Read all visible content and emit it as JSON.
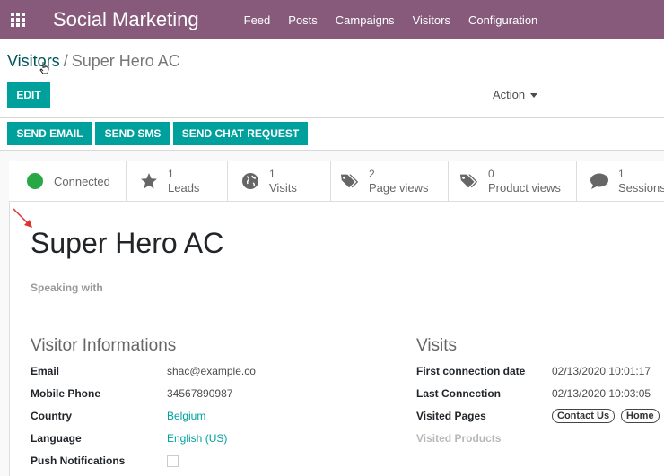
{
  "app": {
    "title": "Social Marketing",
    "menu": [
      "Feed",
      "Posts",
      "Campaigns",
      "Visitors",
      "Configuration"
    ]
  },
  "breadcrumb": {
    "parent": "Visitors",
    "separator": "/",
    "current": "Super Hero AC"
  },
  "control": {
    "edit_label": "EDIT",
    "action_label": "Action"
  },
  "header_buttons": {
    "send_email": "SEND EMAIL",
    "send_sms": "SEND SMS",
    "send_chat": "SEND CHAT REQUEST"
  },
  "stats": {
    "connected": "Connected",
    "leads": {
      "count": "1",
      "label": "Leads"
    },
    "visits": {
      "count": "1",
      "label": "Visits"
    },
    "page_views": {
      "count": "2",
      "label": "Page views"
    },
    "product_views": {
      "count": "0",
      "label": "Product views"
    },
    "sessions": {
      "count": "1",
      "label": "Sessions"
    }
  },
  "record": {
    "name": "Super Hero AC",
    "speaking_with": "Speaking with"
  },
  "visitor_info": {
    "title": "Visitor Informations",
    "email_label": "Email",
    "email": "shac@example.co",
    "mobile_label": "Mobile Phone",
    "mobile": "34567890987",
    "country_label": "Country",
    "country": "Belgium",
    "language_label": "Language",
    "language": "English (US)",
    "push_label": "Push Notifications",
    "push_enabled": false
  },
  "visits": {
    "title": "Visits",
    "first_label": "First connection date",
    "first": "02/13/2020 10:01:17",
    "last_label": "Last Connection",
    "last": "02/13/2020 10:03:05",
    "pages_label": "Visited Pages",
    "pages": [
      "Contact Us",
      "Home"
    ],
    "products_label": "Visited Products"
  },
  "colors": {
    "brand": "#875a7b",
    "primary": "#00a09d",
    "connected": "#28a745",
    "annotation_arrow": "#e03030"
  }
}
